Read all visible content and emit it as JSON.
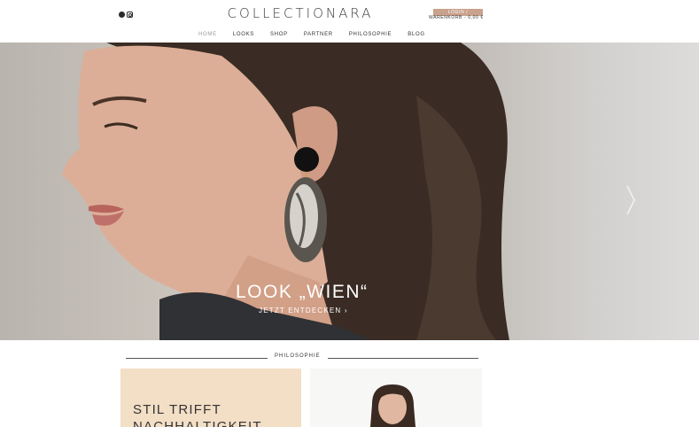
{
  "header": {
    "logo_text": "COLLECTIONARA",
    "account_label": "LOGIN / REGISTRIEREN",
    "cart_label": "WARENKORB - 0,00 €",
    "social": [
      {
        "icon": "pinterest-icon"
      },
      {
        "icon": "instagram-icon"
      }
    ]
  },
  "nav": {
    "items": [
      {
        "label": "HOME",
        "active": true
      },
      {
        "label": "LOOKS"
      },
      {
        "label": "SHOP"
      },
      {
        "label": "PARTNER"
      },
      {
        "label": "PHILOSOPHIE"
      },
      {
        "label": "BLOG"
      }
    ]
  },
  "hero": {
    "title": "LOOK „WIEN“",
    "cta": "JETZT ENTDECKEN ›",
    "next_icon": "chevron-right-icon"
  },
  "section": {
    "heading": "PHILOSOPHIE",
    "card_line1": "STIL TRIFFT",
    "card_line2": "NACHHALTIGKEIT"
  },
  "colors": {
    "accent": "#c9a28d",
    "card_bg": "#f3dec6",
    "text": "#333333"
  }
}
